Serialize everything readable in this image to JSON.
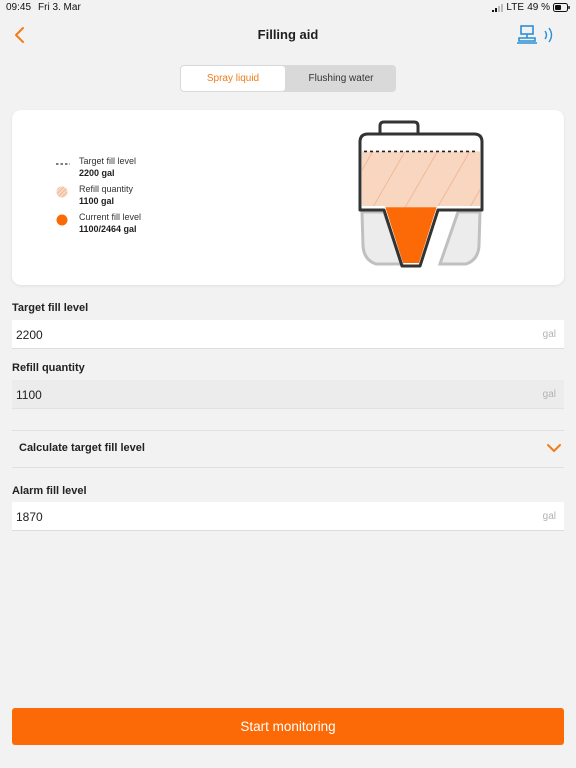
{
  "status_bar": {
    "time": "09:45",
    "date": "Fri 3. Mar",
    "network": "LTE",
    "battery": "49 %"
  },
  "header": {
    "title": "Filling aid",
    "back_icon": "chevron-left-icon",
    "device_icon": "device-wireless-icon"
  },
  "tabs": [
    {
      "label": "Spray liquid",
      "active": true
    },
    {
      "label": "Flushing water",
      "active": false
    }
  ],
  "legend": [
    {
      "label": "Target fill level",
      "value": "2200 gal",
      "symbol": "dashed-line-icon"
    },
    {
      "label": "Refill quantity",
      "value": "1100 gal",
      "symbol": "hatched-circle-icon"
    },
    {
      "label": "Current fill level",
      "value": "1100/2464 gal",
      "symbol": "filled-circle-icon"
    }
  ],
  "tank_levels": {
    "current_fraction": 0.4464,
    "target_fraction": 0.8929
  },
  "form": {
    "target_fill": {
      "label": "Target fill level",
      "value": "2200",
      "unit": "gal"
    },
    "refill": {
      "label": "Refill quantity",
      "value": "1100",
      "unit": "gal"
    },
    "calculate_label": "Calculate target fill level",
    "alarm_fill": {
      "label": "Alarm fill level",
      "value": "1870",
      "unit": "gal"
    }
  },
  "actions": {
    "start_label": "Start monitoring"
  },
  "colors": {
    "accent": "#f07c1b",
    "button": "#fb6a06",
    "refill_fill": "#f9d6bf"
  }
}
